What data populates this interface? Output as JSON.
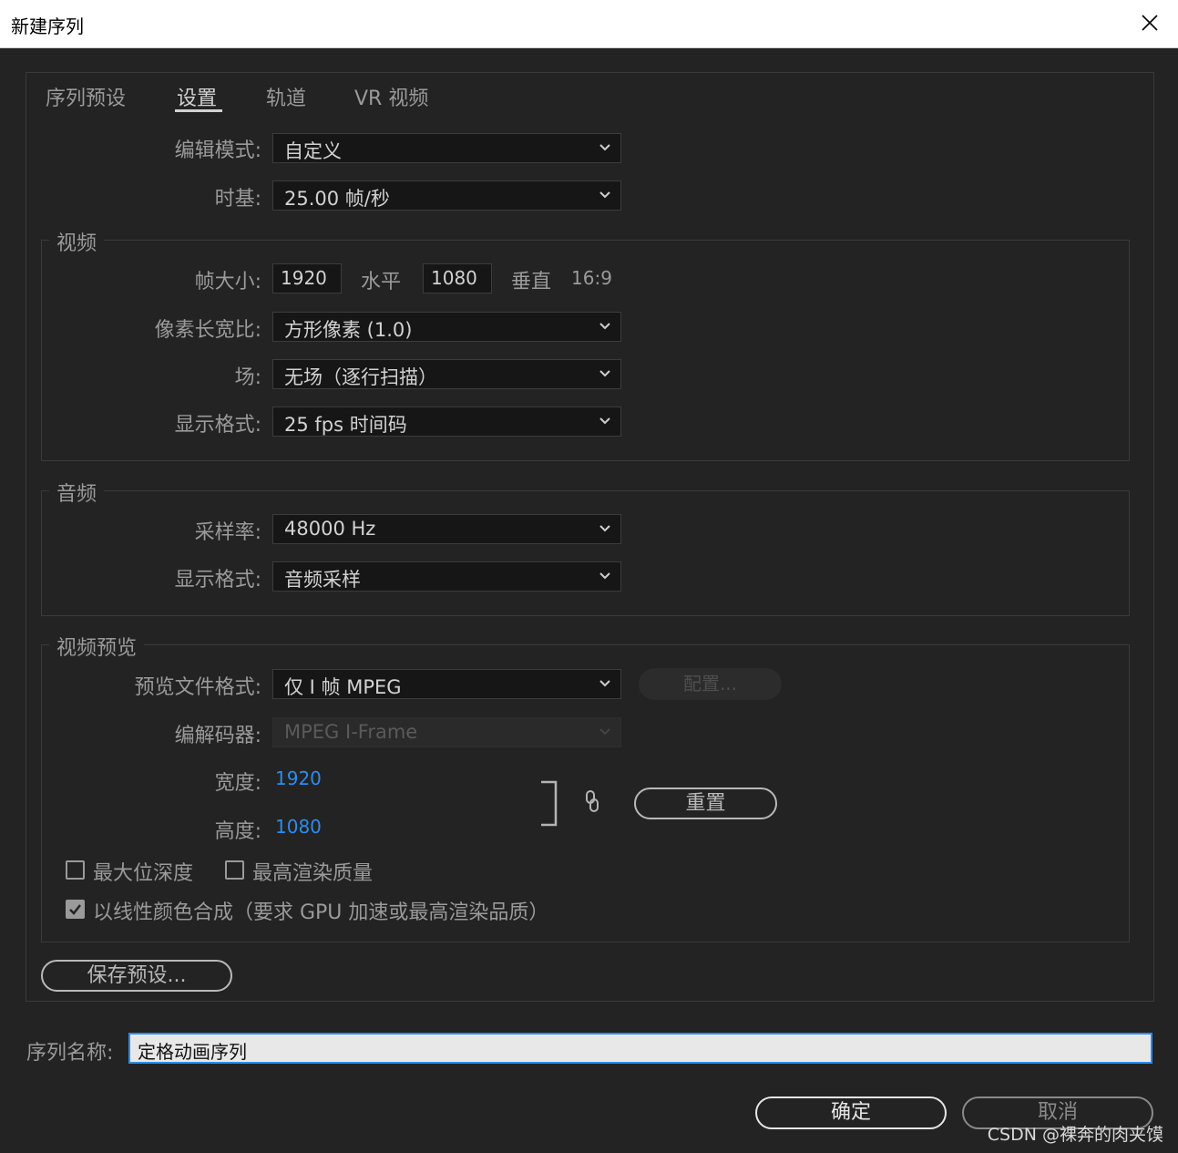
{
  "window": {
    "title": "新建序列",
    "close_icon": "close-icon"
  },
  "tabs": [
    {
      "label": "序列预设",
      "active": false
    },
    {
      "label": "设置",
      "active": true
    },
    {
      "label": "轨道",
      "active": false
    },
    {
      "label": "VR 视频",
      "active": false
    }
  ],
  "general": {
    "editing_mode_label": "编辑模式:",
    "editing_mode_value": "自定义",
    "timebase_label": "时基:",
    "timebase_value": "25.00  帧/秒"
  },
  "video": {
    "group_title": "视频",
    "frame_size_label": "帧大小:",
    "frame_width": "1920",
    "horizontal_label": "水平",
    "frame_height": "1080",
    "vertical_label": "垂直",
    "aspect_ratio": "16:9",
    "pixel_aspect_label": "像素长宽比:",
    "pixel_aspect_value": "方形像素 (1.0)",
    "fields_label": "场:",
    "fields_value": "无场（逐行扫描）",
    "display_format_label": "显示格式:",
    "display_format_value": "25 fps 时间码"
  },
  "audio": {
    "group_title": "音频",
    "sample_rate_label": "采样率:",
    "sample_rate_value": "48000 Hz",
    "display_format_label": "显示格式:",
    "display_format_value": "音频采样"
  },
  "video_preview": {
    "group_title": "视频预览",
    "preview_format_label": "预览文件格式:",
    "preview_format_value": "仅 I 帧 MPEG",
    "configure_label": "配置...",
    "codec_label": "编解码器:",
    "codec_value": "MPEG I-Frame",
    "width_label": "宽度:",
    "width_value": "1920",
    "height_label": "高度:",
    "height_value": "1080",
    "link_icon": "link-icon",
    "reset_label": "重置",
    "max_bit_depth_label": "最大位深度",
    "max_bit_depth_checked": false,
    "max_render_quality_label": "最高渲染质量",
    "max_render_quality_checked": false,
    "linear_color_label": "以线性颜色合成（要求 GPU 加速或最高渲染品质）",
    "linear_color_checked": true
  },
  "save_preset_label": "保存预设...",
  "sequence_name_label": "序列名称:",
  "sequence_name_value": "定格动画序列",
  "ok_label": "确定",
  "cancel_label": "取消",
  "watermark": "CSDN @裸奔的肉夹馍",
  "colors": {
    "accent": "#2d8ceb",
    "background": "#232323"
  }
}
